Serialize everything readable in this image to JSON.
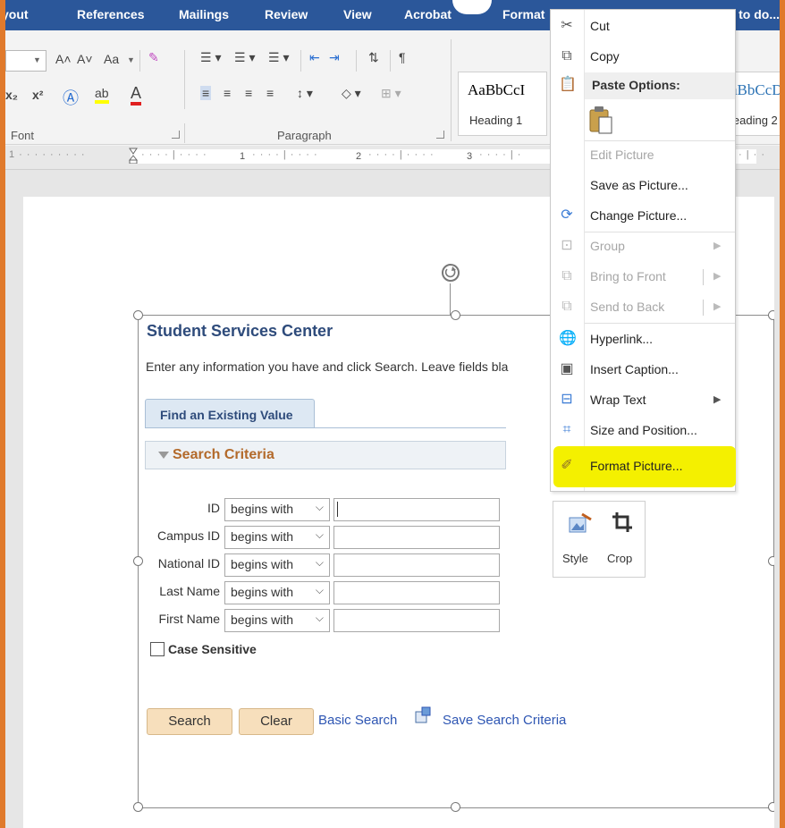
{
  "tabs": [
    "yout",
    "References",
    "Mailings",
    "Review",
    "View",
    "Acrobat",
    "Format",
    "nt to do..."
  ],
  "ribbon": {
    "font_group_label": "Font",
    "paragraph_group_label": "Paragraph",
    "styles": [
      {
        "sample": "AaBbCcI",
        "name": "Heading 1"
      },
      {
        "sample": "aBbCcD",
        "name": "leading 2"
      }
    ],
    "font_buttons": [
      "A˄",
      "A˅",
      "Aa",
      "x₂",
      "x²"
    ]
  },
  "ruler": {
    "numbers": [
      "1",
      "2",
      "3"
    ]
  },
  "picture": {
    "title": "Student Services Center",
    "instruction": "Enter any information you have and click Search. Leave fields bla",
    "tab_label": "Find an Existing Value",
    "section_label": "Search Criteria",
    "rows": [
      {
        "label": "ID",
        "operator": "begins with",
        "value": ""
      },
      {
        "label": "Campus ID",
        "operator": "begins with",
        "value": ""
      },
      {
        "label": "National ID",
        "operator": "begins with",
        "value": ""
      },
      {
        "label": "Last Name",
        "operator": "begins with",
        "value": ""
      },
      {
        "label": "First Name",
        "operator": "begins with",
        "value": ""
      }
    ],
    "case_sensitive_label": "Case Sensitive",
    "search_button": "Search",
    "clear_button": "Clear",
    "basic_search_link": "Basic Search",
    "save_search_link": "Save Search Criteria"
  },
  "context_menu": {
    "cut": "Cut",
    "copy": "Copy",
    "paste_options": "Paste Options:",
    "edit_picture": "Edit Picture",
    "save_as_picture": "Save as Picture...",
    "change_picture": "Change Picture...",
    "group": "Group",
    "bring_to_front": "Bring to Front",
    "send_to_back": "Send to Back",
    "hyperlink": "Hyperlink...",
    "insert_caption": "Insert Caption...",
    "wrap_text": "Wrap Text",
    "size_and_position": "Size and Position...",
    "format_picture": "Format Picture...",
    "highlight_color": "#f4f000"
  },
  "mini_toolbar": {
    "style": "Style",
    "crop": "Crop"
  },
  "colors": {
    "ribbon_blue": "#2b579a",
    "frame_orange": "#e07a2c",
    "link_blue": "#2e56b3"
  }
}
